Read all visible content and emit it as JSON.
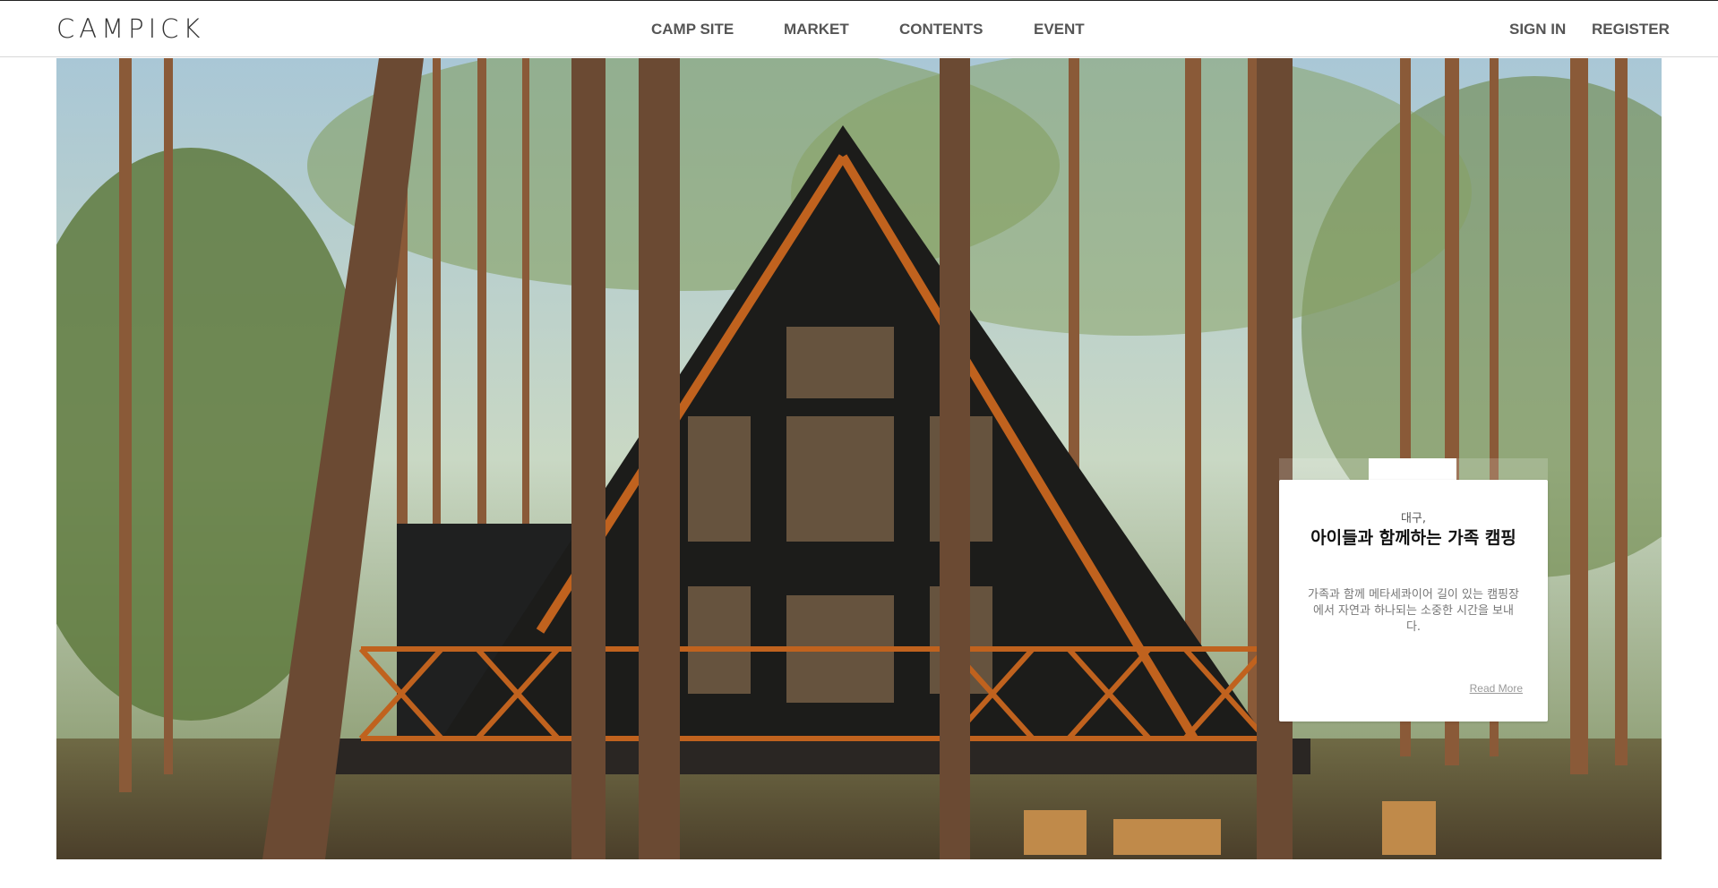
{
  "header": {
    "logo": "CAMPICK",
    "nav": [
      {
        "label": "CAMP SITE"
      },
      {
        "label": "MARKET"
      },
      {
        "label": "CONTENTS"
      },
      {
        "label": "EVENT"
      }
    ],
    "auth": {
      "sign_in": "SIGN IN",
      "register": "REGISTER"
    }
  },
  "hero": {
    "image_alt": "A-frame cabin in a pine forest",
    "card": {
      "region": "대구,",
      "title": "아이들과 함께하는 가족 캠핑",
      "description": "가족과 함께 메타세콰이어 길이 있는 캠핑장에서 자연과 하나되는 소중한 시간을 보내다.",
      "link": "Read More"
    }
  },
  "colors": {
    "text_nav": "#555555",
    "accent_wood": "#c0621e",
    "cabin_dark": "#1c1c1a"
  }
}
